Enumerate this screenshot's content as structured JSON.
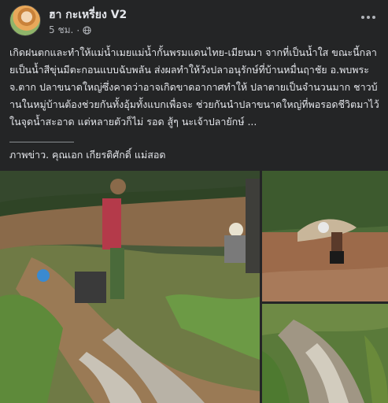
{
  "post": {
    "author": "ฮา กะเหรี่ยง V2",
    "time": "5 ชม.",
    "meta_separator": "·",
    "privacy_icon": "globe-icon",
    "more_icon": "more-options-icon",
    "caption": "เกิดฝนตกและทำให้แม่น้ำเมยแม่น้ำกั้นพรมแดนไทย-เมียนมา จากที่เป็นน้ำใส ขณะนี้กลายเป็นน้ำสีขุ่นมีตะกอนแบบฉับพลัน ส่งผลทำให้วังปลาอนุรักษ์ที่บ้านหมื่นฤาชัย อ.พบพระ จ.ตาก ปลาขนาดใหญ่ซึ่งคาดว่าอาจเกิดขาดอากาศทำให้ ปลาตายเป็นจำนวนมาก ชาวบ้านในหมู่บ้านต้องช่วยกันทั้งอุ้มทั้งแบกเพื่อจะ ช่วยกันนำปลาขนาดใหญ่ที่พอรอดชีวิตมาไว้ในจุดน้ำสะอาด แต่หลายตัวก็ไม่ รอด สู้ๆ นะเจ้าปลายักษ์ ...",
    "credit": "ภาพข่าว. คุณเอก เกียรติศักดิ์ แม่สอด"
  },
  "colors": {
    "background": "#242526",
    "text_primary": "#e4e6eb",
    "text_secondary": "#b0b3b8"
  }
}
